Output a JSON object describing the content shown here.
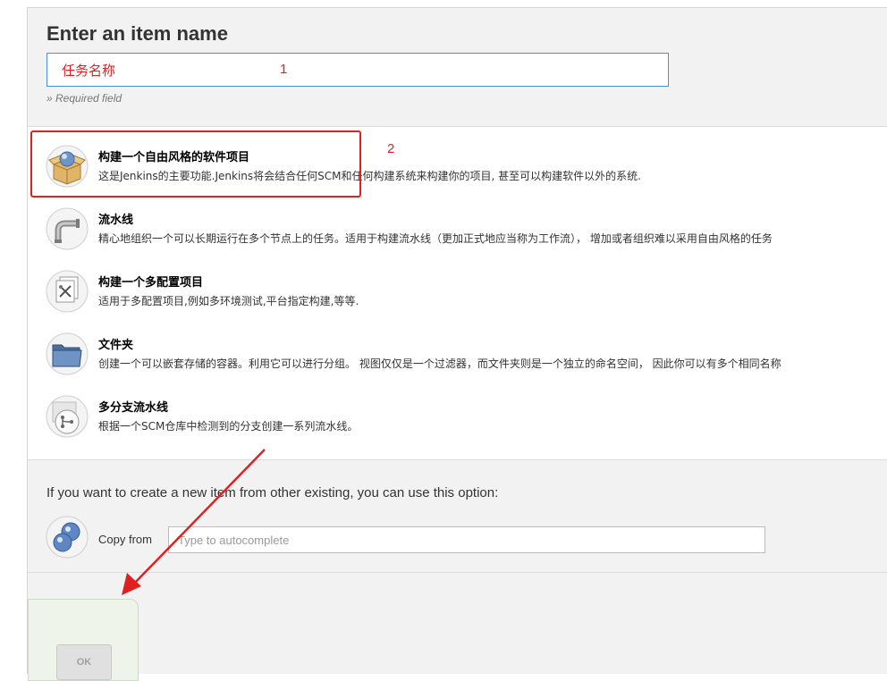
{
  "form": {
    "title": "Enter an item name",
    "name_value": "任务名称",
    "required_note": "» Required field"
  },
  "annotations": {
    "marker_1": "1",
    "marker_2": "2",
    "color": "#e02020"
  },
  "item_types": [
    {
      "icon": "freestyle-box-icon",
      "title": "构建一个自由风格的软件项目",
      "description": "这是Jenkins的主要功能.Jenkins将会结合任何SCM和任何构建系统来构建你的项目, 甚至可以构建软件以外的系统."
    },
    {
      "icon": "pipeline-icon",
      "title": "流水线",
      "description": "精心地组织一个可以长期运行在多个节点上的任务。适用于构建流水线（更加正式地应当称为工作流）， 增加或者组织难以采用自由风格的任务"
    },
    {
      "icon": "multi-config-icon",
      "title": "构建一个多配置项目",
      "description": "适用于多配置项目,例如多环境测试,平台指定构建,等等."
    },
    {
      "icon": "folder-icon",
      "title": "文件夹",
      "description": "创建一个可以嵌套存储的容器。利用它可以进行分组。 视图仅仅是一个过滤器，而文件夹则是一个独立的命名空间， 因此你可以有多个相同名称"
    },
    {
      "icon": "multibranch-pipeline-icon",
      "title": "多分支流水线",
      "description": "根据一个SCM仓库中检测到的分支创建一系列流水线。"
    }
  ],
  "copy": {
    "intro": "If you want to create a new item from other existing, you can use this option:",
    "label": "Copy from",
    "placeholder": "Type to autocomplete",
    "icon": "copy-spheres-icon"
  },
  "footer": {
    "ok_label": "OK"
  }
}
